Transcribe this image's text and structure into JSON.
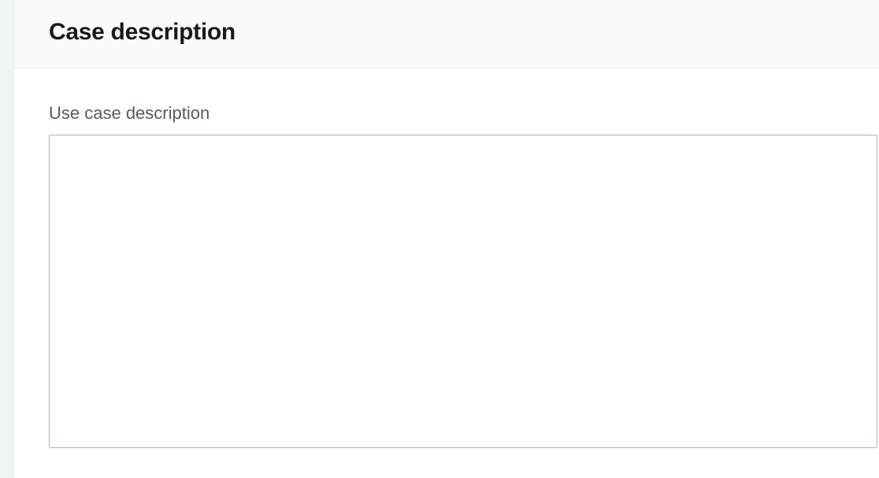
{
  "panel": {
    "title": "Case description"
  },
  "form": {
    "use_case": {
      "label": "Use case description",
      "value": ""
    }
  }
}
